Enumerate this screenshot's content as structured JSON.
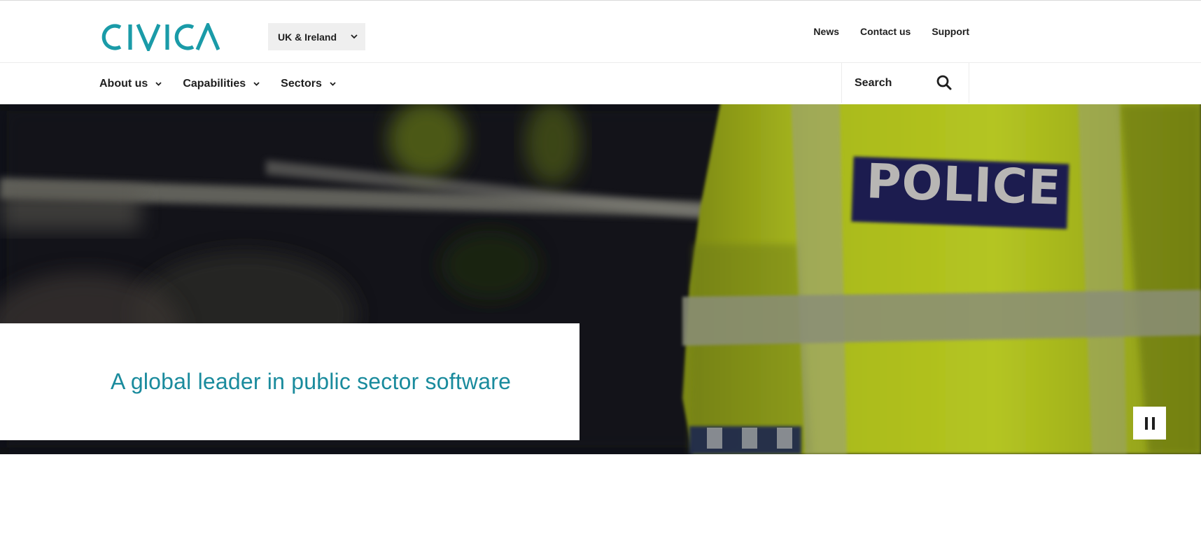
{
  "brand": {
    "logo_text": "CIVICA",
    "accent_color": "#1a9ba8"
  },
  "header": {
    "region_selector": {
      "selected": "UK & Ireland",
      "icon": "chevron-down-icon"
    },
    "utility_links": [
      "News",
      "Contact us",
      "Support"
    ]
  },
  "nav": {
    "items": [
      {
        "label": "About us",
        "icon": "chevron-down-icon"
      },
      {
        "label": "Capabilities",
        "icon": "chevron-down-icon"
      },
      {
        "label": "Sectors",
        "icon": "chevron-down-icon"
      }
    ],
    "search": {
      "label": "Search",
      "icon": "search-icon"
    }
  },
  "hero": {
    "heading": "A global leader in public sector software",
    "background_image": "police officer in high-visibility jacket",
    "background_image_text": "POLICE",
    "heading_color": "#1a8b9d",
    "pause_icon": "pause-icon"
  }
}
